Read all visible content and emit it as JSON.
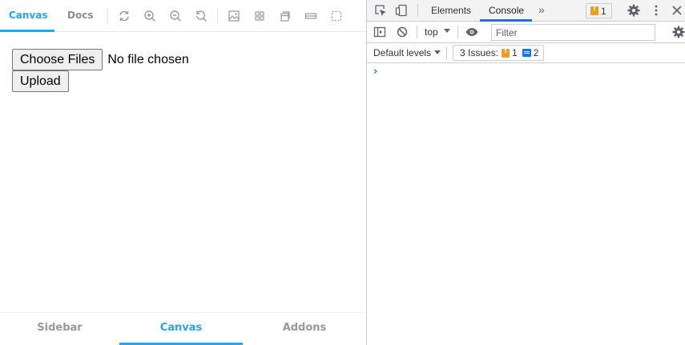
{
  "storybook": {
    "toolbar": {
      "tabs": [
        {
          "label": "Canvas",
          "active": true
        },
        {
          "label": "Docs",
          "active": false
        }
      ],
      "icons": [
        "reload-icon",
        "zoom-in-icon",
        "zoom-out-icon",
        "zoom-reset-icon",
        "background-icon",
        "grid-icon",
        "viewport-icon",
        "measure-icon",
        "outline-icon"
      ]
    },
    "preview": {
      "choose_files_label": "Choose Files",
      "file_status": "No file chosen",
      "upload_label": "Upload"
    },
    "addons_bar": {
      "tabs": [
        {
          "label": "Sidebar",
          "active": false
        },
        {
          "label": "Canvas",
          "active": true
        },
        {
          "label": "Addons",
          "active": false
        }
      ]
    }
  },
  "devtools": {
    "tabs": [
      {
        "label": "Elements",
        "active": false
      },
      {
        "label": "Console",
        "active": true
      }
    ],
    "warning_count": "1",
    "toolbar": {
      "context": "top",
      "filter_placeholder": "Filter"
    },
    "levels_label": "Default levels",
    "issues": {
      "label": "3 Issues:",
      "warnings": "1",
      "info": "2"
    },
    "prompt_symbol": "›"
  },
  "colors": {
    "accent": "#1ea7fd",
    "devtools_blue": "#1a73e8",
    "warning": "#e7a020"
  }
}
